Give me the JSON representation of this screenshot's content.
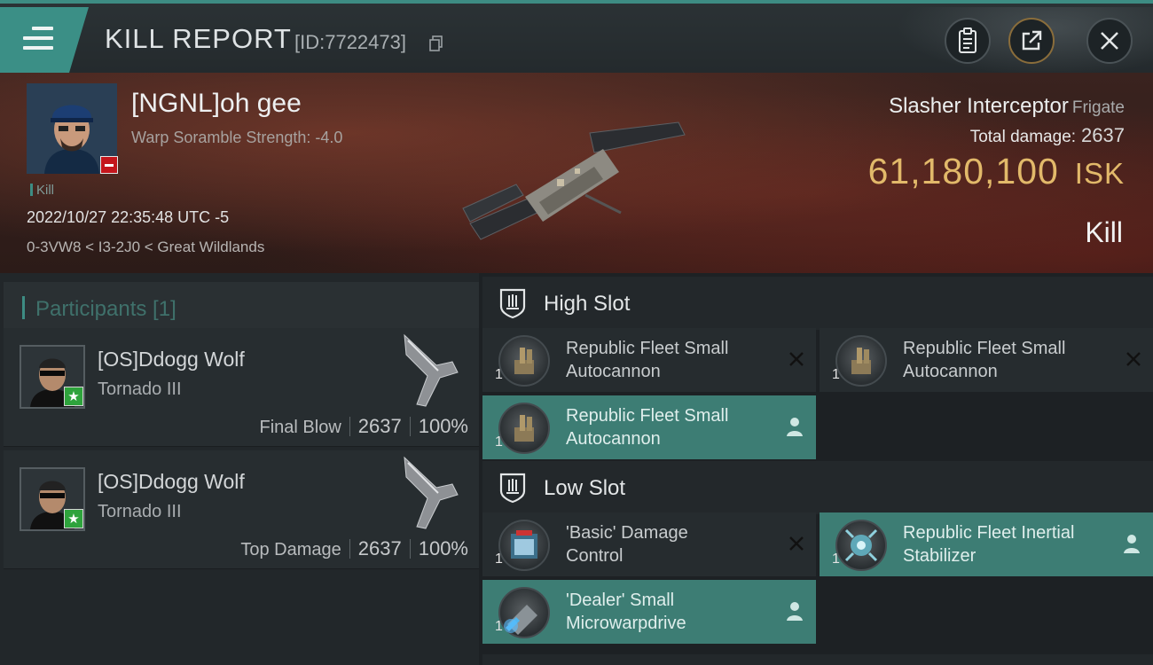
{
  "header": {
    "title": "KILL REPORT",
    "report_id": "[ID:7722473]"
  },
  "victim": {
    "name": "[NGNL]oh gee",
    "warp_scramble": "Warp Soramble Strength: -4.0",
    "tag": "Kill",
    "datetime": "2022/10/27 22:35:48 UTC -5",
    "location": "0-3VW8 < I3-2J0 < Great Wildlands",
    "ship_name": "Slasher Interceptor",
    "ship_class": "Frigate",
    "total_damage_label": "Total damage:",
    "total_damage_value": "2637",
    "isk_value": "61,180,100",
    "isk_unit": "ISK",
    "result": "Kill"
  },
  "participants": {
    "title": "Participants [1]",
    "cards": [
      {
        "name": "[OS]Ddogg Wolf",
        "ship": "Tornado III",
        "label": "Final Blow",
        "damage": "2637",
        "percent": "100%"
      },
      {
        "name": "[OS]Ddogg Wolf",
        "ship": "Tornado III",
        "label": "Top Damage",
        "damage": "2637",
        "percent": "100%"
      }
    ]
  },
  "fittings": {
    "high_slot": {
      "title": "High Slot",
      "modules": [
        {
          "name_line1": "Republic Fleet Small",
          "name_line2": "Autocannon",
          "qty": "1",
          "status": "destroyed"
        },
        {
          "name_line1": "Republic Fleet Small",
          "name_line2": "Autocannon",
          "qty": "1",
          "status": "destroyed"
        },
        {
          "name_line1": "Republic Fleet Small",
          "name_line2": "Autocannon",
          "qty": "1",
          "status": "dropped"
        }
      ]
    },
    "low_slot": {
      "title": "Low Slot",
      "modules": [
        {
          "name_line1": "'Basic' Damage",
          "name_line2": "Control",
          "qty": "1",
          "status": "destroyed"
        },
        {
          "name_line1": "Republic Fleet Inertial",
          "name_line2": "Stabilizer",
          "qty": "1",
          "status": "dropped"
        },
        {
          "name_line1": "'Dealer' Small",
          "name_line2": "Microwarpdrive",
          "qty": "1",
          "status": "dropped"
        }
      ]
    }
  },
  "colors": {
    "accent_teal": "#3d8c83",
    "isk_gold": "#e2b96a",
    "dropped_bg": "#3d7d74",
    "star_green": "#2ea33c",
    "minus_red": "#c4161c"
  }
}
